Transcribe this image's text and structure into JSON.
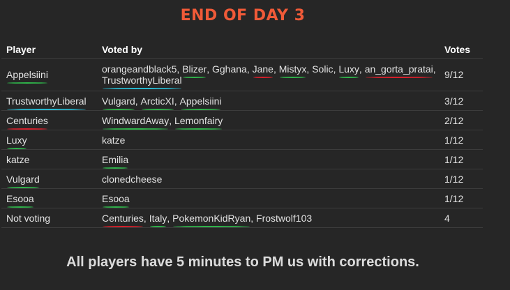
{
  "title": "END OF DAY 3",
  "columns": {
    "player": "Player",
    "voted_by": "Voted by",
    "votes": "Votes"
  },
  "marker_colors": {
    "green": "#2fb34a",
    "red": "#d61f2a",
    "cyan": "#28b8cf"
  },
  "rows": [
    {
      "player": {
        "name": "Appelsiini",
        "mark": "green"
      },
      "voters": [
        {
          "name": "orangeandblack5",
          "mark": ""
        },
        {
          "name": "Blizer",
          "mark": "green"
        },
        {
          "name": "Gghana",
          "mark": ""
        },
        {
          "name": "Jane",
          "mark": "red"
        },
        {
          "name": "Mistyx",
          "mark": "green"
        },
        {
          "name": "Solic",
          "mark": ""
        },
        {
          "name": "Luxy",
          "mark": "green"
        },
        {
          "name": "an_gorta_pratai",
          "mark": "red"
        },
        {
          "name": "TrustworthyLiberal",
          "mark": "cyan"
        }
      ],
      "votes": "9/12"
    },
    {
      "player": {
        "name": "TrustworthyLiberal",
        "mark": "cyan"
      },
      "voters": [
        {
          "name": "Vulgard",
          "mark": "green"
        },
        {
          "name": "ArcticXI",
          "mark": "green"
        },
        {
          "name": "Appelsiini",
          "mark": "green"
        }
      ],
      "votes": "3/12"
    },
    {
      "player": {
        "name": "Centuries",
        "mark": "red"
      },
      "voters": [
        {
          "name": "WindwardAway",
          "mark": "green"
        },
        {
          "name": "Lemonfairy",
          "mark": "green"
        }
      ],
      "votes": "2/12"
    },
    {
      "player": {
        "name": "Luxy",
        "mark": "green"
      },
      "voters": [
        {
          "name": "katze",
          "mark": ""
        }
      ],
      "votes": "1/12"
    },
    {
      "player": {
        "name": "katze",
        "mark": ""
      },
      "voters": [
        {
          "name": "Emilia",
          "mark": "green"
        }
      ],
      "votes": "1/12"
    },
    {
      "player": {
        "name": "Vulgard",
        "mark": "green"
      },
      "voters": [
        {
          "name": "clonedcheese",
          "mark": ""
        }
      ],
      "votes": "1/12"
    },
    {
      "player": {
        "name": "Esooa",
        "mark": "green"
      },
      "voters": [
        {
          "name": "Esooa",
          "mark": "green"
        }
      ],
      "votes": "1/12"
    },
    {
      "player": {
        "name": "Not voting",
        "mark": ""
      },
      "voters": [
        {
          "name": "Centuries",
          "mark": "red"
        },
        {
          "name": "Italy",
          "mark": "green"
        },
        {
          "name": "PokemonKidRyan",
          "mark": "green"
        },
        {
          "name": "Frostwolf103",
          "mark": ""
        }
      ],
      "votes": "4"
    }
  ],
  "footer": "All players have 5 minutes to PM us with corrections."
}
